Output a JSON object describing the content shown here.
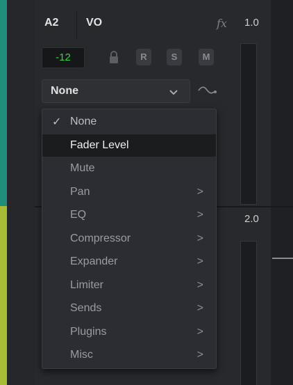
{
  "header": {
    "track_id": "A2",
    "track_name": "VO",
    "fx_label": "fx",
    "channel_1_value": "1.0",
    "channel_2_value": "2.0"
  },
  "controls": {
    "level": "-12",
    "level_color": "#3dd14a",
    "record_label": "R",
    "solo_label": "S",
    "mute_label": "M"
  },
  "automation": {
    "selected": "None"
  },
  "menu": {
    "items": [
      {
        "label": "None",
        "checked": true,
        "submenu": false
      },
      {
        "label": "Fader Level",
        "checked": false,
        "submenu": false,
        "highlighted": true
      },
      {
        "label": "Mute",
        "checked": false,
        "submenu": false
      },
      {
        "label": "Pan",
        "checked": false,
        "submenu": true
      },
      {
        "label": "EQ",
        "checked": false,
        "submenu": true
      },
      {
        "label": "Compressor",
        "checked": false,
        "submenu": true
      },
      {
        "label": "Expander",
        "checked": false,
        "submenu": true
      },
      {
        "label": "Limiter",
        "checked": false,
        "submenu": true
      },
      {
        "label": "Sends",
        "checked": false,
        "submenu": true
      },
      {
        "label": "Plugins",
        "checked": false,
        "submenu": true
      },
      {
        "label": "Misc",
        "checked": false,
        "submenu": true
      }
    ],
    "check_glyph": "✓",
    "submenu_glyph": ">"
  },
  "colors": {
    "track_top": "#1f8f7c",
    "track_bottom": "#a8bd35"
  }
}
